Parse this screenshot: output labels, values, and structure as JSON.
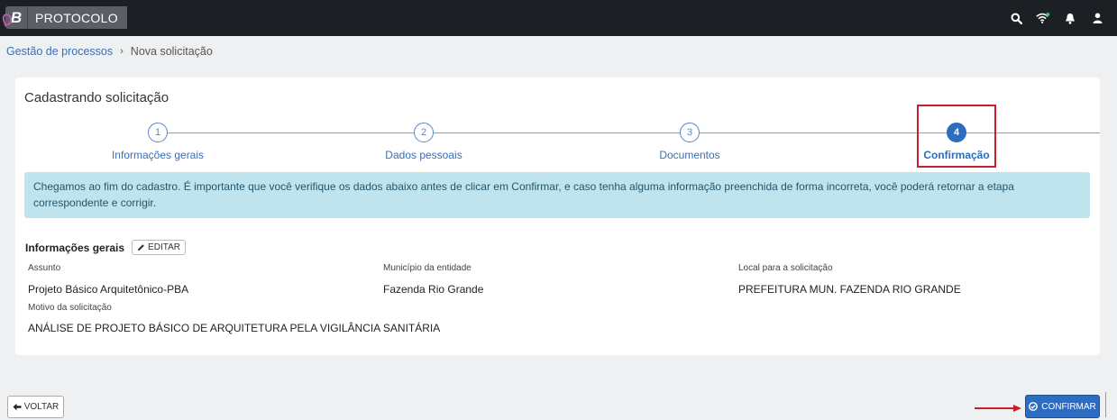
{
  "app": {
    "brand_letter": "B",
    "module_name": "PROTOCOLO"
  },
  "topbar": {
    "icons": [
      "search-icon",
      "wifi-icon",
      "bell-icon",
      "user-icon"
    ],
    "status_dot_color": "#2ecc71"
  },
  "breadcrumb": {
    "parent": "Gestão de processos",
    "separator": "›",
    "current": "Nova solicitação"
  },
  "page": {
    "title": "Cadastrando solicitação"
  },
  "stepper": {
    "steps": [
      {
        "number": "1",
        "label": "Informações gerais"
      },
      {
        "number": "2",
        "label": "Dados pessoais"
      },
      {
        "number": "3",
        "label": "Documentos"
      },
      {
        "number": "4",
        "label": "Confirmação"
      }
    ],
    "active_step": 4
  },
  "alert": {
    "text": "Chegamos ao fim do cadastro. É importante que você verifique os dados abaixo antes de clicar em Confirmar, e caso tenha alguma informação preenchida de forma incorreta, você poderá retornar a etapa correspondente e corrigir."
  },
  "summary": {
    "section_title": "Informações gerais",
    "edit_label": "EDITAR",
    "fields": {
      "assunto": {
        "label": "Assunto",
        "value": "Projeto Básico Arquitetônico-PBA"
      },
      "municipio": {
        "label": "Município da entidade",
        "value": "Fazenda Rio Grande"
      },
      "local": {
        "label": "Local para a solicitação",
        "value": "PREFEITURA MUN. FAZENDA RIO GRANDE"
      },
      "motivo": {
        "label": "Motivo da solicitação",
        "value": "ANÁLISE DE PROJETO BÁSICO DE ARQUITETURA PELA VIGILÂNCIA SANITÁRIA"
      }
    }
  },
  "actions": {
    "back_label": "VOLTAR",
    "confirm_label": "CONFIRMAR"
  },
  "colors": {
    "topbar": "#1c1f23",
    "primary": "#2d6cc0",
    "alert_bg": "#bfe4ee",
    "annotation_red": "#c8202a"
  }
}
